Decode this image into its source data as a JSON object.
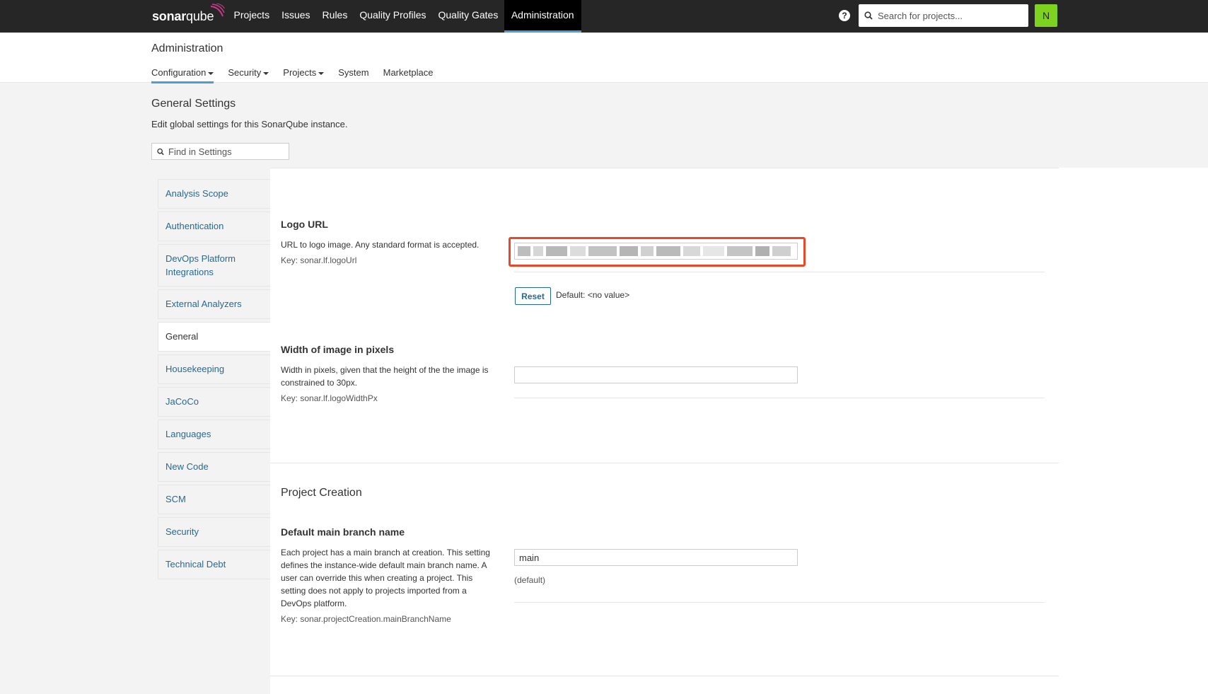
{
  "topnav": {
    "logo": {
      "brand": "sonar",
      "product": "qube"
    },
    "items": [
      {
        "label": "Projects"
      },
      {
        "label": "Issues"
      },
      {
        "label": "Rules"
      },
      {
        "label": "Quality Profiles"
      },
      {
        "label": "Quality Gates"
      },
      {
        "label": "Administration",
        "active": true
      }
    ],
    "help_icon": "?",
    "search_placeholder": "Search for projects...",
    "avatar_initial": "N"
  },
  "admin": {
    "title": "Administration",
    "tabs": [
      {
        "label": "Configuration",
        "has_caret": true,
        "active": true
      },
      {
        "label": "Security",
        "has_caret": true
      },
      {
        "label": "Projects",
        "has_caret": true
      },
      {
        "label": "System"
      },
      {
        "label": "Marketplace"
      }
    ]
  },
  "settings": {
    "title": "General Settings",
    "subtitle": "Edit global settings for this SonarQube instance.",
    "find_placeholder": "Find in Settings"
  },
  "sidebar": {
    "items": [
      {
        "label": "Analysis Scope"
      },
      {
        "label": "Authentication"
      },
      {
        "label": "DevOps Platform Integrations"
      },
      {
        "label": "External Analyzers"
      },
      {
        "label": "General",
        "active": true
      },
      {
        "label": "Housekeeping"
      },
      {
        "label": "JaCoCo"
      },
      {
        "label": "Languages"
      },
      {
        "label": "New Code"
      },
      {
        "label": "SCM"
      },
      {
        "label": "Security"
      },
      {
        "label": "Technical Debt"
      }
    ]
  },
  "logo_url": {
    "title": "Logo URL",
    "description": "URL to logo image. Any standard format is accepted.",
    "key": "Key: sonar.lf.logoUrl",
    "reset_label": "Reset",
    "default_text": "Default: <no value>"
  },
  "logo_width": {
    "title": "Width of image in pixels",
    "description": "Width in pixels, given that the height of the the image is constrained to 30px.",
    "key": "Key: sonar.lf.logoWidthPx",
    "value": ""
  },
  "project_creation": {
    "section_title": "Project Creation",
    "title": "Default main branch name",
    "description": "Each project has a main branch at creation. This setting defines the instance-wide default main branch name. A user can override this when creating a project. This setting does not apply to projects imported from a DevOps platform.",
    "key": "Key: sonar.projectCreation.mainBranchName",
    "value": "main",
    "default_hint": "(default)"
  },
  "colors": {
    "topnav_bg": "#262626",
    "accent_blue": "#4b9fd5",
    "link_blue": "#236a97",
    "avatar_green": "#7ed321",
    "highlight_red": "#e8482a"
  }
}
